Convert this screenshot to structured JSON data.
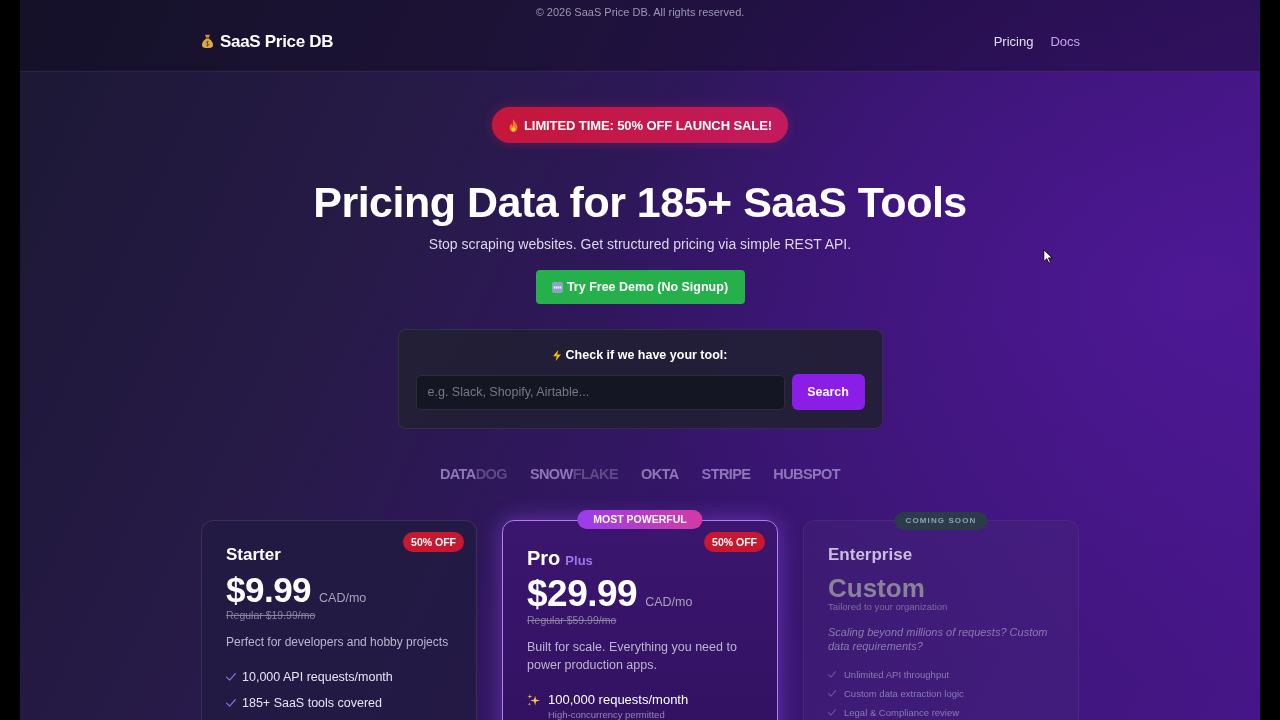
{
  "footer_note": "© 2026 SaaS Price DB. All rights reserved.",
  "nav": {
    "logo": "SaaS Price DB",
    "links": [
      {
        "label": "Pricing",
        "selected": false
      },
      {
        "label": "Docs",
        "selected": true
      }
    ]
  },
  "hero": {
    "badge": "LIMITED TIME: 50% OFF LAUNCH SALE!",
    "title": "Pricing Data for 185+ SaaS Tools",
    "subtitle": "Stop scraping websites. Get structured pricing via simple REST API.",
    "cta": "Try Free Demo (No Signup)"
  },
  "search": {
    "heading": "Check if we have your tool:",
    "placeholder": "e.g. Slack, Shopify, Airtable...",
    "button": "Search"
  },
  "logos": [
    {
      "text": "DATA",
      "faded_text": "DOG"
    },
    {
      "text": "SNOW",
      "faded_text": "FLAKE"
    },
    {
      "text": "OKTA"
    },
    {
      "text": "STRIPE"
    },
    {
      "text": "HUBSPOT"
    }
  ],
  "plans": [
    {
      "name": "Starter",
      "discount": "50% OFF",
      "price": "$9.99",
      "period": "CAD/mo",
      "regular": "Regular $19.99/mo",
      "description": "Perfect for developers and hobby projects",
      "features": [
        {
          "kind": "standard",
          "text": "10,000 API requests/month"
        },
        {
          "kind": "standard",
          "text": "185+ SaaS tools covered"
        }
      ],
      "highlighted": false,
      "disabled": false
    },
    {
      "name": "Pro",
      "tier": "Plus",
      "ribbon": "MOST POWERFUL",
      "discount": "50% OFF",
      "price": "$29.99",
      "period": "CAD/mo",
      "regular": "Regular $59.99/mo",
      "description": "Built for scale. Everything you need to power production apps.",
      "features": [
        {
          "kind": "featured",
          "text": "100,000 requests/month",
          "note": "High-concurrency permitted"
        }
      ],
      "highlighted": true,
      "disabled": false
    },
    {
      "name": "Enterprise",
      "ribbon": "COMING SOON",
      "price": "Custom",
      "price_note": "Tailored to your organization",
      "description": "Scaling beyond millions of requests? Custom data requirements?",
      "features": [
        {
          "kind": "standard",
          "text": "Unlimited API throughput"
        },
        {
          "kind": "standard",
          "text": "Custom data extraction logic"
        },
        {
          "kind": "standard",
          "text": "Legal & Compliance review"
        }
      ],
      "highlighted": false,
      "disabled": true
    }
  ]
}
